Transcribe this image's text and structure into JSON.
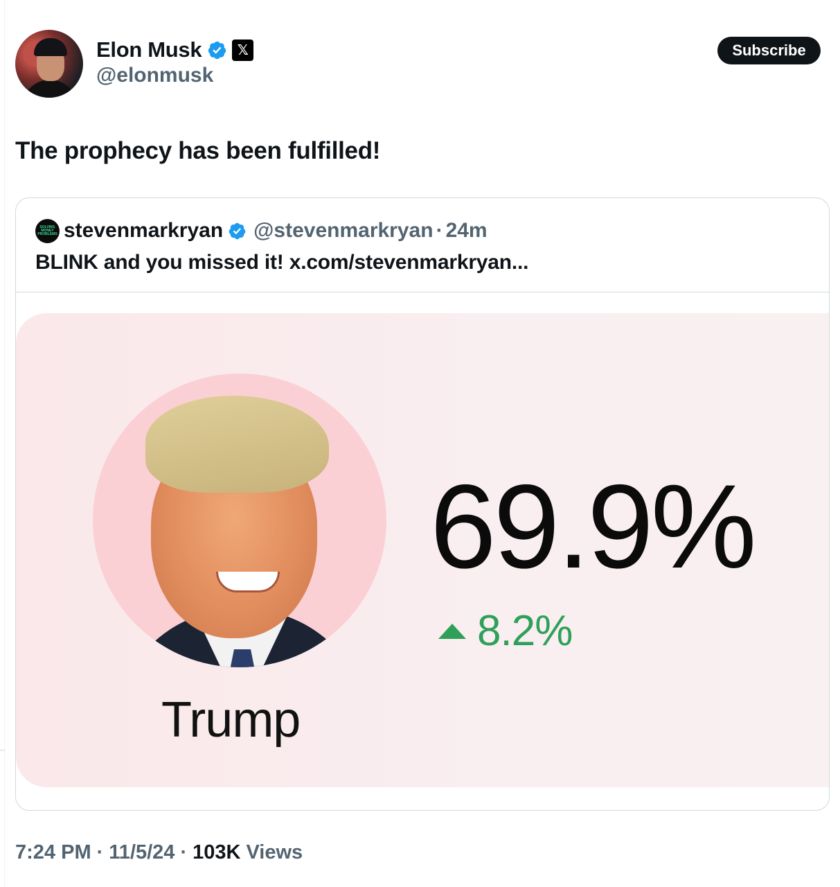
{
  "author": {
    "display_name": "Elon Musk",
    "handle": "@elonmusk",
    "verified_icon": "verified-badge-icon",
    "affiliation_icon": "x-logo-icon",
    "affiliation_glyph": "𝕏"
  },
  "subscribe": {
    "label": "Subscribe"
  },
  "tweet": {
    "text": "The prophecy has been fulfilled!"
  },
  "quoted": {
    "display_name": "stevenmarkryan",
    "avatar_text": "SOLVING MONEY PROBLEMS",
    "handle": "@stevenmarkryan",
    "separator": "·",
    "time": "24m",
    "text": "BLINK and you missed it! x.com/stevenmarkryan...",
    "media": {
      "candidate": "Trump",
      "probability": "69.9%",
      "change": "8.2%",
      "change_direction": "up",
      "change_color": "#2fa05a"
    }
  },
  "footer": {
    "time": "7:24 PM",
    "date": "11/5/24",
    "views_count": "103K",
    "views_label": "Views",
    "separator": "·"
  },
  "colors": {
    "text_primary": "#0f1419",
    "text_secondary": "#536471",
    "verified_blue": "#1d9bf0",
    "border": "#cfd9de"
  }
}
